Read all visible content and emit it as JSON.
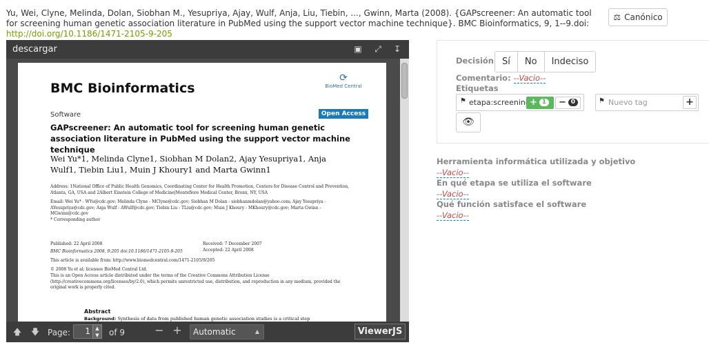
{
  "citation": {
    "text": "Yu, Wei, Clyne, Melinda, Dolan, Siobhan M., Yesupriya, Ajay, Wulf, Anja, Liu, Tiebin, ..., Gwinn, Marta (2008). {GAPscreener: An automatic tool for screening human genetic association literature in PubMed using the support vector machine technique}. BMC Bioinformatics, 9, 1--9.doi:",
    "doi_link": "http://doi.org/10.1186/1471-2105-9-205",
    "canon_button": "Canónico"
  },
  "viewer": {
    "title": "descargar",
    "pdf": {
      "journal": "BMC Bioinformatics",
      "publisher": "BioMed Central",
      "section": "Software",
      "open_access": "Open Access",
      "title": "GAPscreener: An automatic tool for screening human genetic association literature in PubMed using the support vector machine technique",
      "authors": "Wei Yu*1, Melinda Clyne1, Siobhan M Dolan2, Ajay Yesupriya1, Anja Wulf1, Tiebin Liu1, Muin J Khoury1 and Marta Gwinn1",
      "address": "Address: 1National Office of Public Health Genomics, Coordinating Center for Health Promotion, Centers for Disease Control and Prevention, Atlanta, GA, USA and 2Albert Einstein College of Medicine|Montefiore Medical Center, Bronx, NY, USA",
      "email": "Email: Wei Yu* - WYu@cdc.gov; Melinda Clyne - MClyne@cdc.gov; Siobhan M Dolan - siobhanmdolan@yahoo.com; Ajay Yesupriya - AYesupriya@cdc.gov; Anja Wulf - AWulf@cdc.gov; Tiebin Liu - TLiu@cdc.gov; Muin J Khoury - MKhoury@cdc.gov; Marta Gwinn - MGwinn@cdc.gov",
      "corresponding": "* Corresponding author",
      "published": "Published: 22 April 2008",
      "citation_line": "BMC Bioinformatics 2008, 9:205    doi:10.1186/1471-2105-9-205",
      "available": "This article is available from: http://www.biomedcentral.com/1471-2105/9/205",
      "received": "Received: 7 December 2007",
      "accepted": "Accepted: 22 April 2008",
      "copyright": "© 2008 Yu et al; licensee BioMed Central Ltd.",
      "license": "This is an Open Access article distributed under the terms of the Creative Commons Attribution License (http://creativecommons.org/licenses/by/2.0), which permits unrestricted use, distribution, and reproduction in any medium, provided the original work is properly cited.",
      "abstract_heading": "Abstract",
      "abstract_bg_label": "Background:",
      "abstract_bg": "Synthesis of data from published human genetic association studies is a critical step"
    },
    "toolbar": {
      "page_label": "Page:",
      "page_value": "1",
      "of_label": "of 9",
      "zoom_minus": "−",
      "zoom_plus": "+",
      "zoom_select": "Automatic",
      "viewerjs": "ViewerJS"
    }
  },
  "panel": {
    "decision_label": "Decisión",
    "decision_options": [
      "Sí",
      "No",
      "Indeciso"
    ],
    "comment_label": "Comentario:",
    "comment_value": "--Vacio--",
    "tags_label": "Etiquetas",
    "tag": {
      "name": "etapa:screening",
      "plus": "+",
      "plus_count": "1",
      "minus": "−",
      "minus_count": "0"
    },
    "new_tag_placeholder": "Nuevo tag",
    "add_tag": "+"
  },
  "fields": [
    {
      "label": "Herramienta informática utilizada y objetivo",
      "value": "--Vacio--"
    },
    {
      "label": "En qué etapa se utiliza el software",
      "value": "--Vacio--"
    },
    {
      "label": "Qué función satisface el software",
      "value": "--Vacio--"
    }
  ],
  "icons": {
    "canon": "scale-icon",
    "tag": "tag-icon",
    "eye": "eye-icon",
    "presentation": "presentation-icon",
    "fullscreen": "fullscreen-icon",
    "download": "download-icon",
    "prev": "arrow-up-icon",
    "next": "arrow-down-icon"
  },
  "colors": {
    "link": "#7a9a00",
    "vacio": "#b94a48",
    "plus_green": "#5cb85c",
    "open_access": "#1a7bb8",
    "viewer_bg": "#4a4a4a"
  }
}
